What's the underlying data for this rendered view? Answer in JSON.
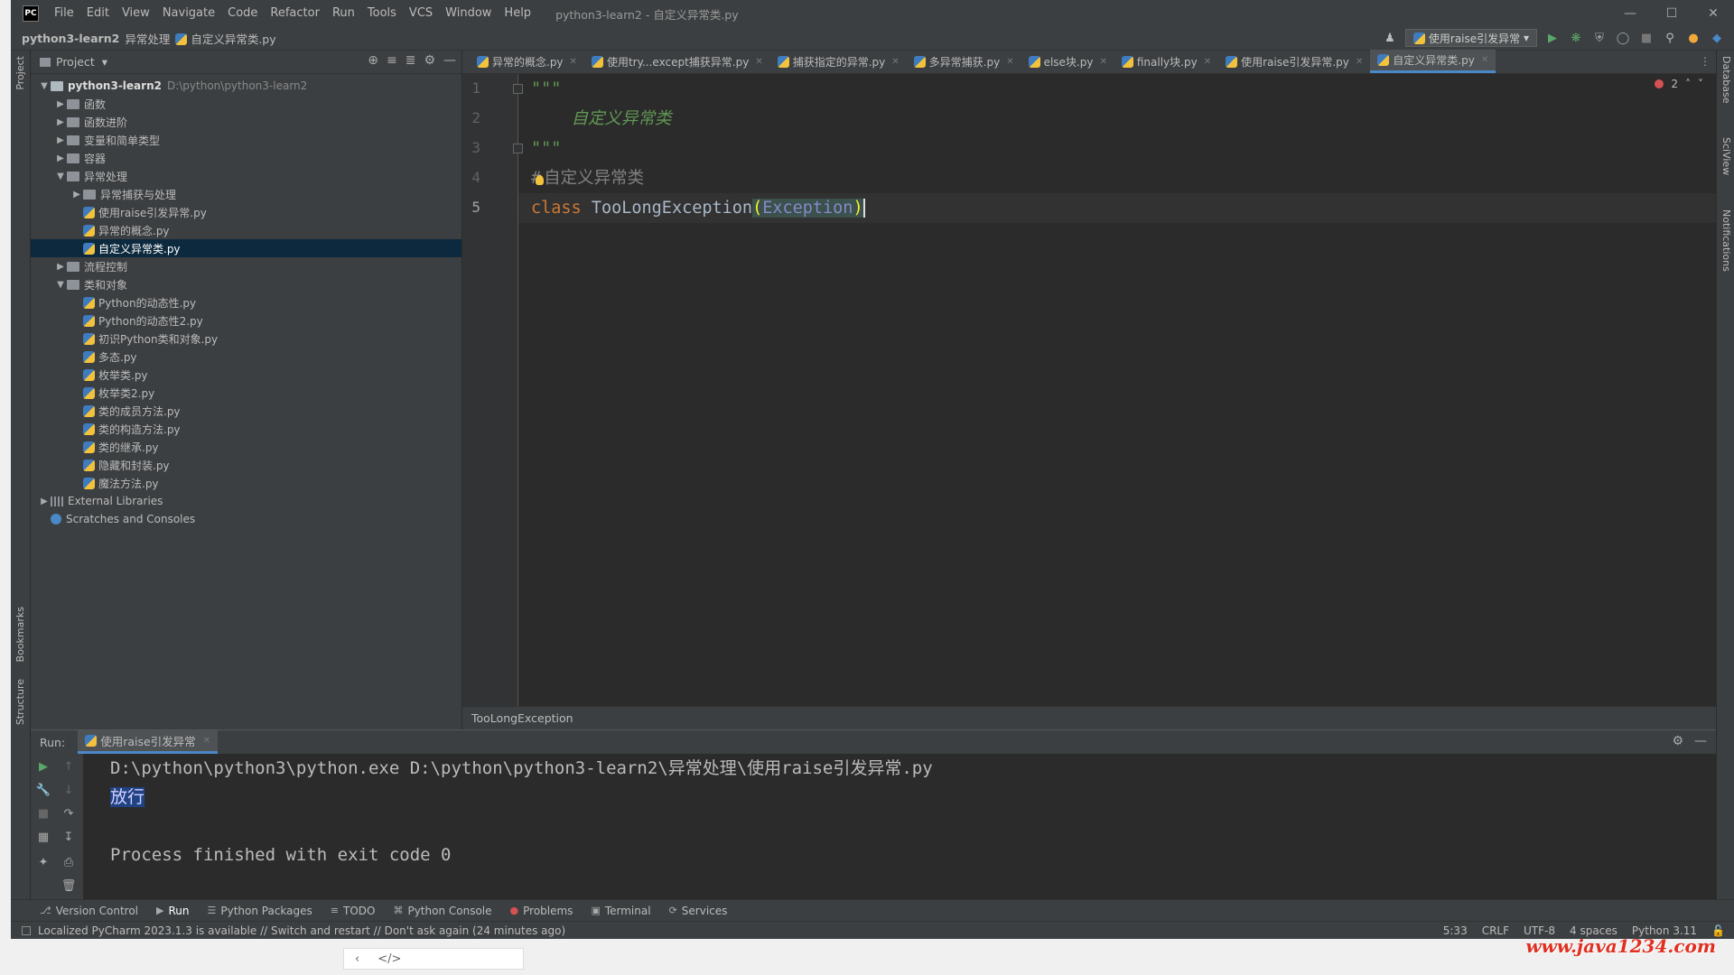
{
  "window": {
    "title": "python3-learn2 - 自定义异常类.py",
    "menu": [
      "File",
      "Edit",
      "View",
      "Navigate",
      "Code",
      "Refactor",
      "Run",
      "Tools",
      "VCS",
      "Window",
      "Help"
    ],
    "logo": "PC"
  },
  "navbar": {
    "crumbs": [
      "python3-learn2",
      "异常处理",
      "自定义异常类.py"
    ],
    "run_config": "使用raise引发异常"
  },
  "left_strip": {
    "project": "Project",
    "bookmarks": "Bookmarks",
    "structure": "Structure"
  },
  "right_strip": {
    "database": "Database",
    "sciview": "SciView",
    "notifications": "Notifications"
  },
  "project": {
    "header": "Project",
    "root": {
      "name": "python3-learn2",
      "path": "D:\\python\\python3-learn2"
    },
    "items": [
      {
        "label": "函数",
        "type": "folder",
        "level": 1,
        "state": "collapsed"
      },
      {
        "label": "函数进阶",
        "type": "folder",
        "level": 1,
        "state": "collapsed"
      },
      {
        "label": "变量和简单类型",
        "type": "folder",
        "level": 1,
        "state": "collapsed"
      },
      {
        "label": "容器",
        "type": "folder",
        "level": 1,
        "state": "collapsed"
      },
      {
        "label": "异常处理",
        "type": "folder",
        "level": 1,
        "state": "expanded"
      },
      {
        "label": "异常捕获与处理",
        "type": "folder",
        "level": 2,
        "state": "collapsed"
      },
      {
        "label": "使用raise引发异常.py",
        "type": "file",
        "level": 2
      },
      {
        "label": "异常的概念.py",
        "type": "file",
        "level": 2
      },
      {
        "label": "自定义异常类.py",
        "type": "file",
        "level": 2,
        "selected": true
      },
      {
        "label": "流程控制",
        "type": "folder",
        "level": 1,
        "state": "collapsed"
      },
      {
        "label": "类和对象",
        "type": "folder",
        "level": 1,
        "state": "expanded"
      },
      {
        "label": "Python的动态性.py",
        "type": "file",
        "level": 2
      },
      {
        "label": "Python的动态性2.py",
        "type": "file",
        "level": 2
      },
      {
        "label": "初识Python类和对象.py",
        "type": "file",
        "level": 2
      },
      {
        "label": "多态.py",
        "type": "file",
        "level": 2
      },
      {
        "label": "枚举类.py",
        "type": "file",
        "level": 2
      },
      {
        "label": "枚举类2.py",
        "type": "file",
        "level": 2
      },
      {
        "label": "类的成员方法.py",
        "type": "file",
        "level": 2
      },
      {
        "label": "类的构造方法.py",
        "type": "file",
        "level": 2
      },
      {
        "label": "类的继承.py",
        "type": "file",
        "level": 2
      },
      {
        "label": "隐藏和封装.py",
        "type": "file",
        "level": 2
      },
      {
        "label": "魔法方法.py",
        "type": "file",
        "level": 2
      }
    ],
    "external_libraries": "External Libraries",
    "scratches": "Scratches and Consoles"
  },
  "editor": {
    "tabs": [
      "异常的概念.py",
      "使用try...except捕获异常.py",
      "捕获指定的异常.py",
      "多异常捕获.py",
      "else块.py",
      "finally块.py",
      "使用raise引发异常.py",
      "自定义异常类.py"
    ],
    "active_tab": 7,
    "line_numbers": [
      "1",
      "2",
      "3",
      "4",
      "5"
    ],
    "code": {
      "l1": "\"\"\"",
      "l2": "    自定义异常类",
      "l3": "\"\"\"",
      "l4_hash": "#",
      "l4_text": "自定义异常类",
      "l5_kw": "class",
      "l5_name": " TooLongException",
      "l5_open": "(",
      "l5_base": "Exception",
      "l5_close": ")"
    },
    "error_count": "2",
    "breadcrumb": "TooLongException"
  },
  "run": {
    "label": "Run:",
    "tab": "使用raise引发异常",
    "lines": {
      "cmd": "D:\\python\\python3\\python.exe D:\\python\\python3-learn2\\异常处理\\使用raise引发异常.py",
      "out": "放行",
      "exit": "Process finished with exit code 0"
    }
  },
  "bottom_tabs": [
    "Version Control",
    "Run",
    "Python Packages",
    "TODO",
    "Python Console",
    "Problems",
    "Terminal",
    "Services"
  ],
  "status": {
    "message": "Localized PyCharm 2023.1.3 is available // Switch and restart // Don't ask again (24 minutes ago)",
    "position": "5:33",
    "line_sep": "CRLF",
    "encoding": "UTF-8",
    "indent": "4 spaces",
    "interpreter": "Python 3.11"
  },
  "watermark": "www.java1234.com",
  "colors": {
    "accent": "#4a88c7",
    "bg_editor": "#2b2b2b",
    "bg_panel": "#3c3f41",
    "selection": "#0d293e"
  }
}
